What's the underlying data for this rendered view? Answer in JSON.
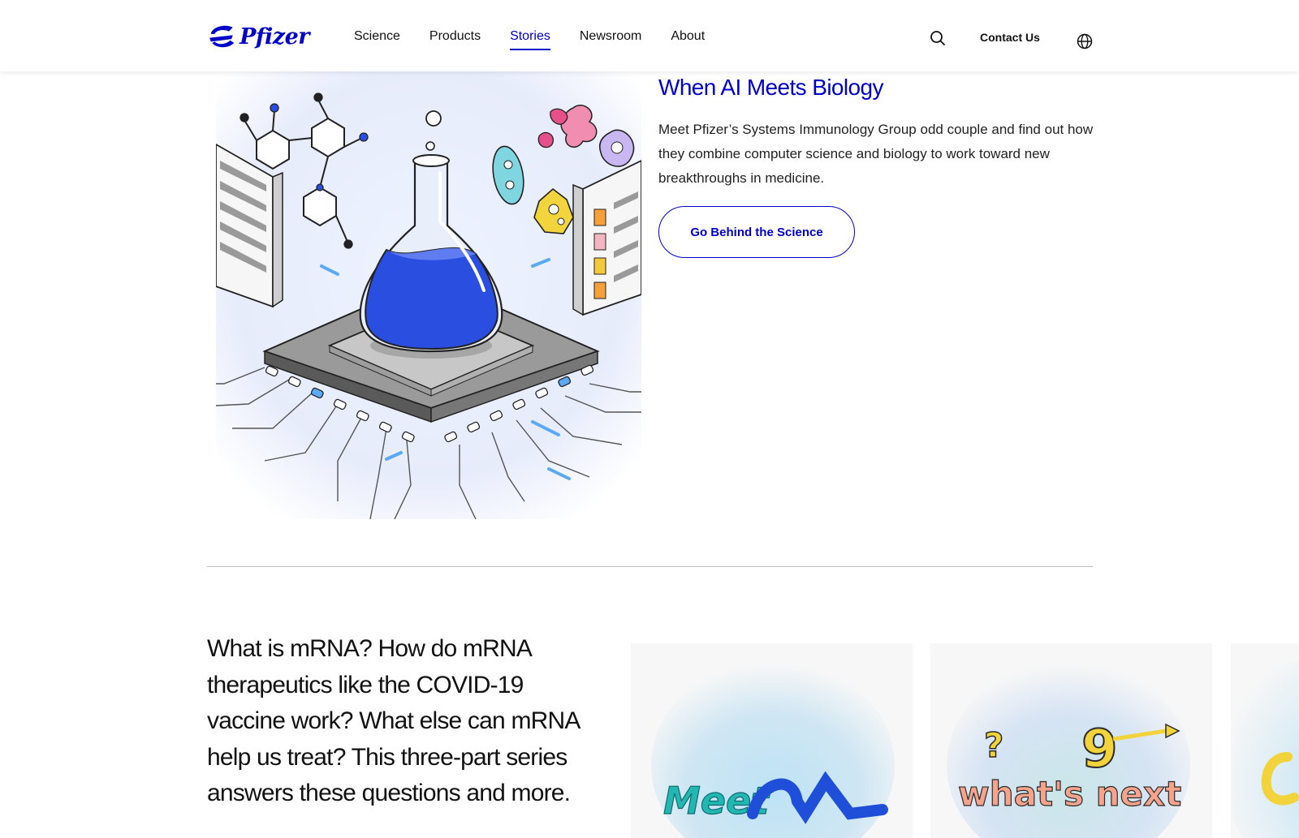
{
  "header": {
    "brand": "Pfizer",
    "nav": [
      {
        "label": "Science"
      },
      {
        "label": "Products"
      },
      {
        "label": "Stories"
      },
      {
        "label": "Newsroom"
      },
      {
        "label": "About"
      }
    ],
    "active_nav": "Stories",
    "contact_label": "Contact Us"
  },
  "hero": {
    "title": "When AI Meets Biology",
    "description": "Meet Pfizer’s Systems Immunology Group odd couple and find out how they combine computer science and biology to work toward new breakthroughs in medicine.",
    "cta_label": "Go Behind the Science"
  },
  "mrna": {
    "intro": "What is mRNA? How do mRNA therapeutics like the COVID-19 vaccine work? What else can mRNA help us treat? This three-part series answers these questions and more.",
    "cards": [
      {
        "art_text": "Meet"
      },
      {
        "art_text": "what's next"
      },
      {
        "art_text": ""
      }
    ]
  },
  "colors": {
    "brand_blue": "#0000c9",
    "flask_blue": "#2a4fe0",
    "divider": "#bdbdbd"
  },
  "icons": {
    "search": "search-icon",
    "language": "globe-icon",
    "logo": "pfizer-logo"
  }
}
